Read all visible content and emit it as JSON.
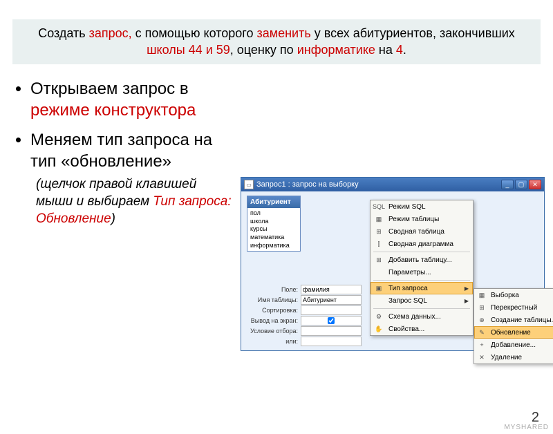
{
  "title": {
    "p1": "Создать ",
    "kw1": "запрос,",
    "p2": " с помощью которого ",
    "kw2": "заменить",
    "p3": " у всех абитуриентов, закончивших ",
    "kw3": "школы 44 и 59",
    "p4": ", оценку по ",
    "kw4": "информатике",
    "p5": " на ",
    "kw5": "4",
    "p6": "."
  },
  "bullets": {
    "b1a": "Открываем запрос в ",
    "b1b": "режиме конструктора",
    "b2": "Меняем тип запроса на тип «обновление»"
  },
  "note": {
    "n1": "(щелчок правой клавишей мыши и выбираем ",
    "n2": "Тип запроса: Обновление",
    "n3": ")"
  },
  "window": {
    "title": "Запрос1 : запрос на выборку",
    "tablebox_header": "Абитуриент",
    "fields": [
      "пол",
      "школа",
      "курсы",
      "математика",
      "информатика"
    ]
  },
  "grid": {
    "rows": [
      {
        "label": "Поле:",
        "value": "фамилия"
      },
      {
        "label": "Имя таблицы:",
        "value": "Абитуриент"
      },
      {
        "label": "Сортировка:",
        "value": ""
      },
      {
        "label": "Вывод на экран:",
        "value": "checkbox"
      },
      {
        "label": "Условие отбора:",
        "value": ""
      },
      {
        "label": "или:",
        "value": ""
      }
    ]
  },
  "menu1": {
    "items": [
      {
        "icon": "SQL",
        "label": "Режим SQL"
      },
      {
        "icon": "▦",
        "label": "Режим таблицы"
      },
      {
        "icon": "⊞",
        "label": "Сводная таблица"
      },
      {
        "icon": "⫿",
        "label": "Сводная диаграмма"
      },
      {
        "icon": "⊞",
        "label": "Добавить таблицу..."
      },
      {
        "icon": "",
        "label": "Параметры..."
      },
      {
        "icon": "▣",
        "label": "Тип запроса",
        "submenu": true,
        "hover": true
      },
      {
        "icon": "",
        "label": "Запрос SQL",
        "submenu": true
      },
      {
        "icon": "⚙",
        "label": "Схема данных..."
      },
      {
        "icon": "✋",
        "label": "Свойства..."
      }
    ]
  },
  "menu2": {
    "items": [
      {
        "icon": "▦",
        "label": "Выборка"
      },
      {
        "icon": "⊞",
        "label": "Перекрестный"
      },
      {
        "icon": "⊕",
        "label": "Создание таблицы..."
      },
      {
        "icon": "✎",
        "label": "Обновление",
        "hover": true
      },
      {
        "icon": "+",
        "label": "Добавление..."
      },
      {
        "icon": "✕",
        "label": "Удаление"
      }
    ]
  },
  "page_number": "2",
  "watermark": "MYSHARED"
}
